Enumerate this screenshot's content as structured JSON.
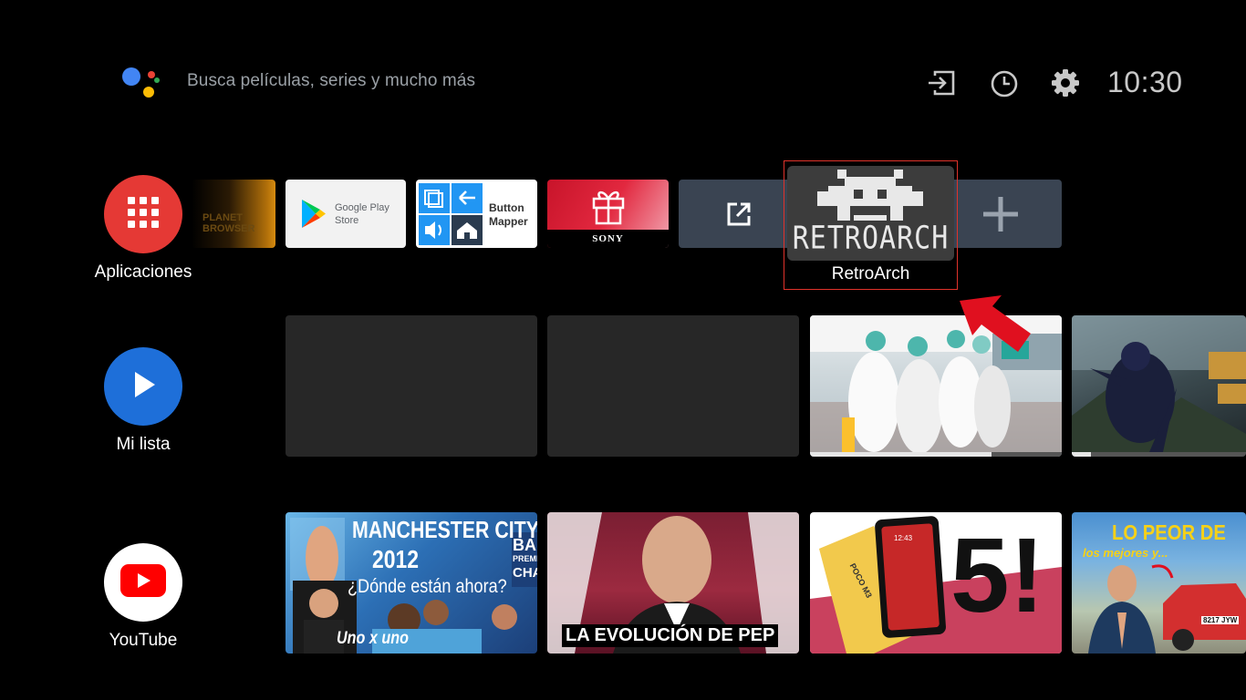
{
  "search": {
    "placeholder_text": "Busca películas, series y mucho más",
    "assistant_icon": "google-assistant-icon"
  },
  "header": {
    "icons": [
      "input-source-icon",
      "timer-icon",
      "settings-gear-icon"
    ],
    "time": "10:30"
  },
  "nav": {
    "apps": {
      "label": "Aplicaciones",
      "icon": "apps-grid-icon",
      "color": "#e53935"
    },
    "watchlist": {
      "label": "Mi lista",
      "icon": "play-icon",
      "color": "#1e6fd9"
    },
    "youtube": {
      "label": "YouTube",
      "icon": "youtube-icon",
      "color": "#ffffff"
    }
  },
  "apps_row": {
    "planet_browser": {
      "text_line1": "PLANET",
      "text_line2": "BROWSER"
    },
    "google_play": {
      "line1": "Google Play",
      "line2": "Store"
    },
    "button_mapper": {
      "line1": "Button",
      "line2": "Mapper"
    },
    "sony": {
      "label": "SONY"
    },
    "open_external": {
      "icon": "open-external-icon"
    },
    "retroarch": {
      "logo_text": "RETROARCH",
      "label": "RetroArch"
    },
    "add": {
      "icon": "plus-icon"
    }
  },
  "watchlist_row": {
    "progress": [
      0.72,
      0.11
    ]
  },
  "youtube_row": {
    "video1": {
      "title_line1": "MANCHESTER CITY",
      "title_line2": "2012",
      "title_line3": "¿Dónde están ahora?",
      "caption": "Uno x uno",
      "side": "BA",
      "side2": "PREMI",
      "side3": "CHA"
    },
    "video2": {
      "caption": "LA EVOLUCIÓN DE PEP"
    },
    "video3": {
      "big_text": "5!",
      "phone_brand": "POCO M3",
      "phone_time": "12:43"
    },
    "video4": {
      "title_line1": "LO PEOR DE",
      "title_line2": "los mejores y...",
      "plate": "8217 JYW"
    }
  },
  "colors": {
    "background": "#000000",
    "focus_border": "#e0322a",
    "tile_slate": "#3a4452",
    "arrow": "#e0101f"
  }
}
